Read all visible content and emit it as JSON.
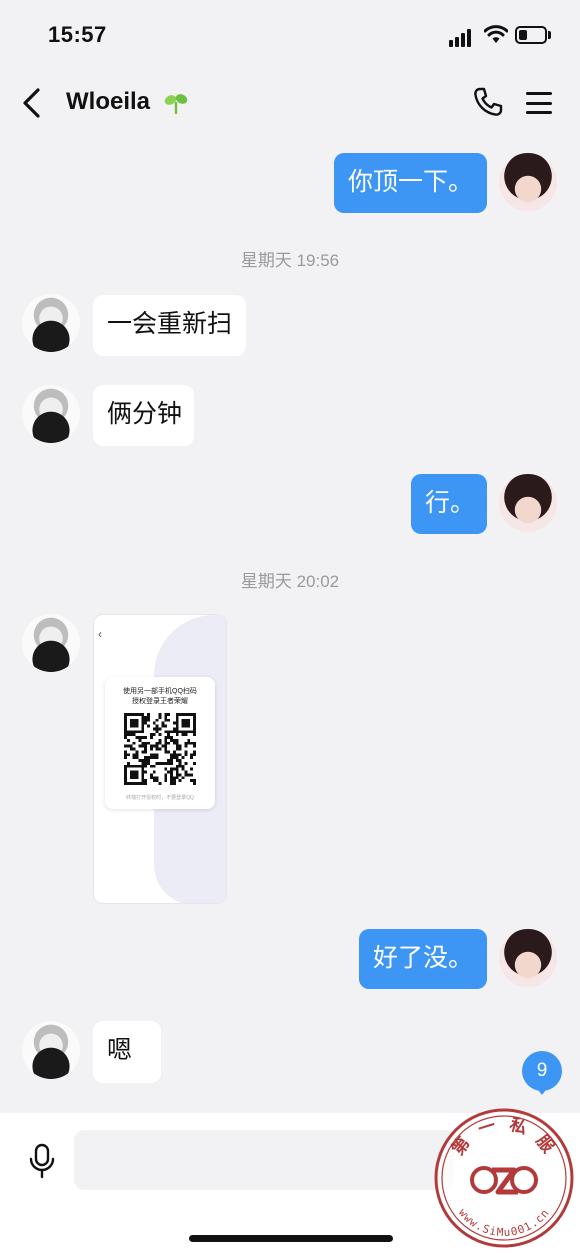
{
  "status_bar": {
    "time": "15:57",
    "battery_level": 0.35
  },
  "header": {
    "title": "Wloeila",
    "icons": [
      "back-icon",
      "sprout-icon",
      "phone-icon",
      "menu-icon"
    ]
  },
  "messages": [
    {
      "side": "mine",
      "text": "你顶一下。"
    },
    {
      "type": "timestamp",
      "text": "星期天 19:56"
    },
    {
      "side": "theirs",
      "text": "一会重新扫"
    },
    {
      "side": "theirs",
      "text": "俩分钟"
    },
    {
      "side": "mine",
      "text": "行。"
    },
    {
      "type": "timestamp",
      "text": "星期天 20:02"
    },
    {
      "side": "theirs",
      "type": "image",
      "image": {
        "back": "‹",
        "line1": "使用另一部手机QQ扫码",
        "line2": "授权登录王者荣耀",
        "footer": "终端打开授权时，不要登录QQ"
      }
    },
    {
      "side": "mine",
      "text": "好了没。"
    },
    {
      "side": "theirs",
      "text": "嗯"
    }
  ],
  "unread_badge": "9",
  "watermark": {
    "top_text": "第 一 私 服",
    "bottom_text": "www.SiMu001.cn"
  },
  "colors": {
    "accent": "#3d95f4",
    "background": "#f2f2f4",
    "watermark": "#b33a3a"
  }
}
